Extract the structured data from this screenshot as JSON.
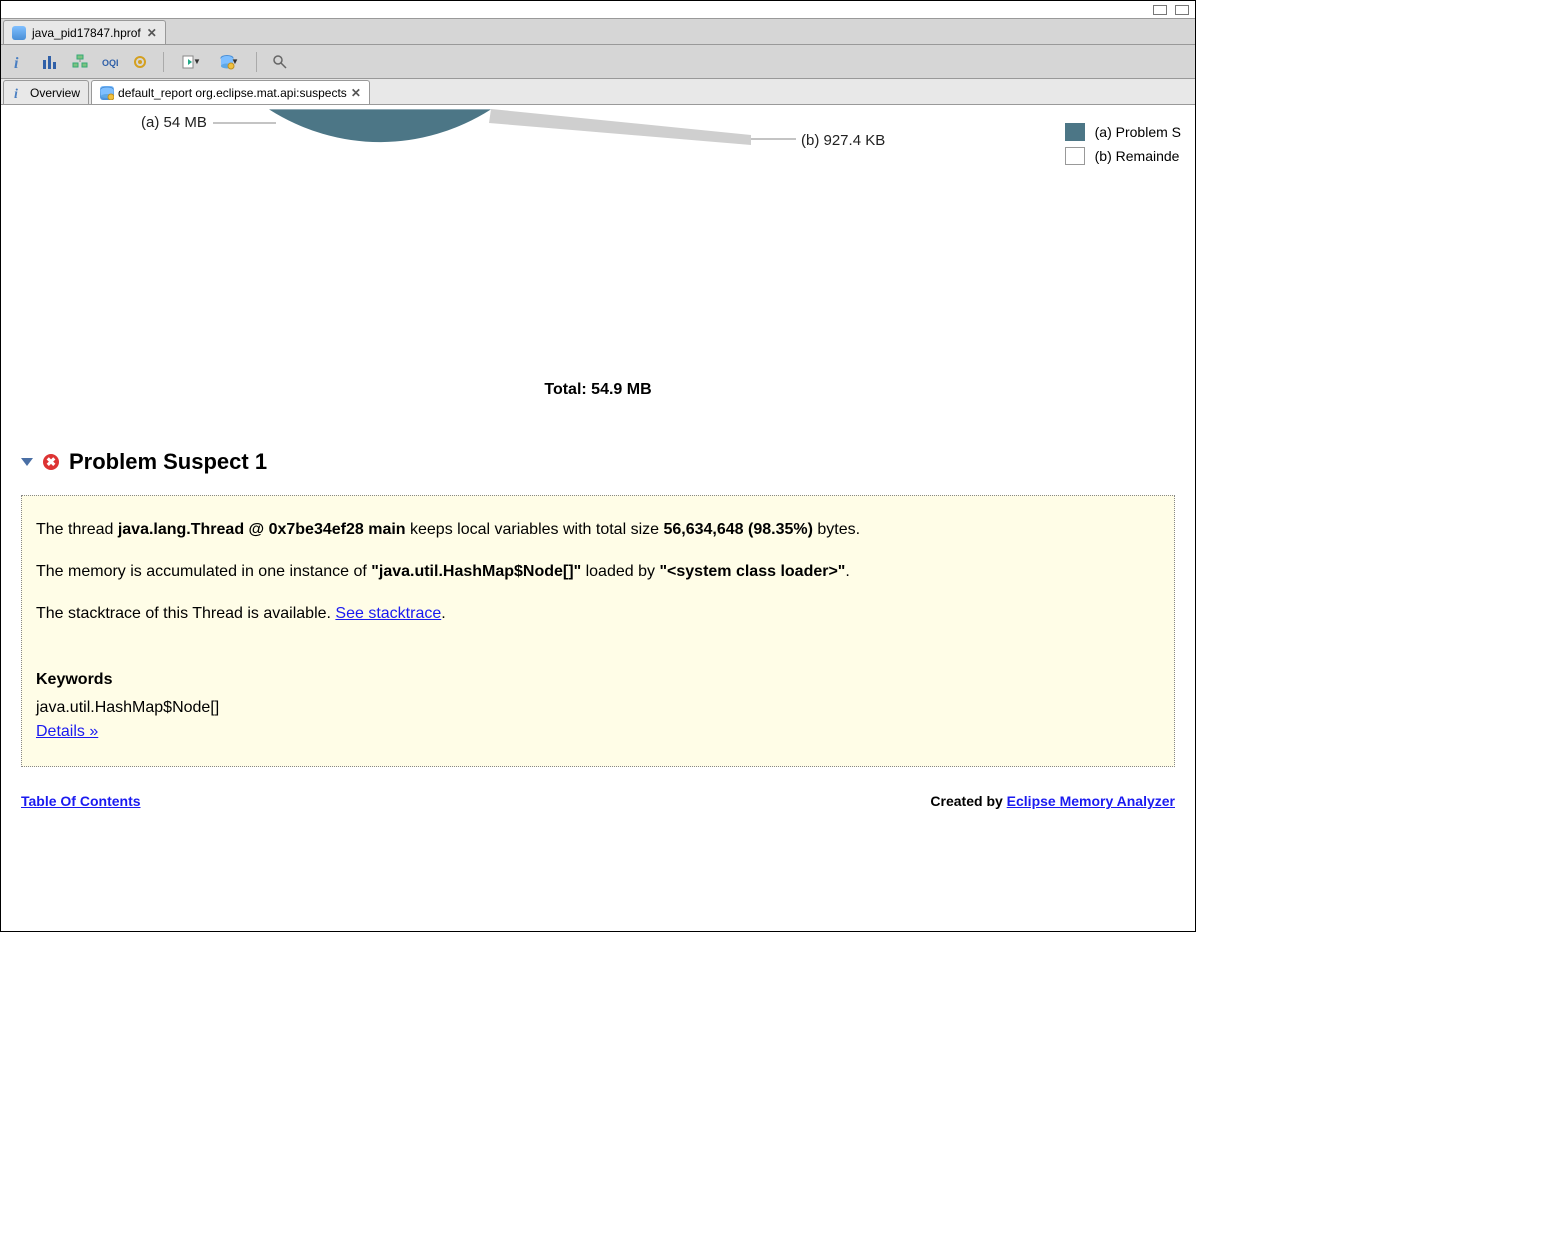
{
  "editorTab": {
    "label": "java_pid17847.hprof"
  },
  "subTabs": {
    "overview": "Overview",
    "report": "default_report  org.eclipse.mat.api:suspects"
  },
  "chart_data": {
    "type": "pie",
    "series": [
      {
        "name": "(a) Problem S",
        "label_on_chart": "(a)  54 MB",
        "value_mb": 54.0,
        "color": "#4c7686"
      },
      {
        "name": "(b) Remainde",
        "label_on_chart": "(b)  927.4 KB",
        "value_mb": 0.9057,
        "color": "#d0d0d0"
      }
    ],
    "total_label": "Total: 54.9 MB"
  },
  "legend": {
    "a": "(a)  Problem S",
    "b": "(b)  Remainde"
  },
  "section": {
    "title": "Problem Suspect 1"
  },
  "detail": {
    "p1_pre": "The thread ",
    "p1_bold1": "java.lang.Thread @ 0x7be34ef28 main",
    "p1_mid": " keeps local variables with total size ",
    "p1_bold2": "56,634,648 (98.35%)",
    "p1_post": " bytes.",
    "p2_pre": "The memory is accumulated in one instance of ",
    "p2_bold1": "\"java.util.HashMap$Node[]\"",
    "p2_mid": " loaded by ",
    "p2_bold2": "\"<system class loader>\"",
    "p2_post": ".",
    "p3_pre": "The stacktrace of this Thread is available. ",
    "p3_link": "See stacktrace",
    "p3_post": ".",
    "kw_heading": "Keywords",
    "kw_value": "java.util.HashMap$Node[]",
    "details_link": "Details »"
  },
  "footer": {
    "toc": "Table Of Contents",
    "created_pre": "Created by ",
    "created_link": "Eclipse Memory Analyzer"
  }
}
